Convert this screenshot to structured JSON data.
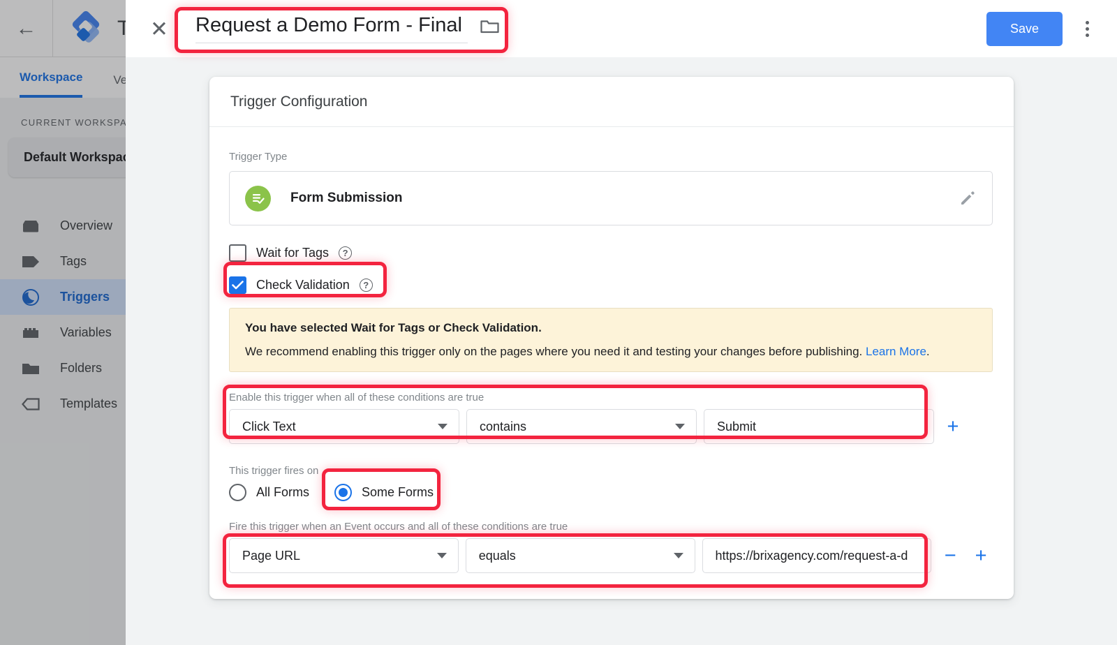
{
  "app": {
    "back_icon": "back-arrow-icon",
    "brand_title": "Tag Manager",
    "tabs": [
      {
        "label": "Workspace",
        "active": true
      },
      {
        "label": "Versions",
        "active": false
      }
    ],
    "sidebar": {
      "section_label": "CURRENT WORKSPACE",
      "workspace_name": "Default Workspace",
      "items": [
        {
          "label": "Overview",
          "icon": "overview-icon",
          "active": false
        },
        {
          "label": "Tags",
          "icon": "tag-icon",
          "active": false
        },
        {
          "label": "Triggers",
          "icon": "trigger-icon",
          "active": true
        },
        {
          "label": "Variables",
          "icon": "variables-icon",
          "active": false
        },
        {
          "label": "Folders",
          "icon": "folder-icon",
          "active": false
        },
        {
          "label": "Templates",
          "icon": "template-icon",
          "active": false
        }
      ]
    }
  },
  "modal": {
    "close_icon": "close-icon",
    "title_value": "Request a Demo Form - Final CTA",
    "title_placeholder": "Untitled Trigger",
    "folder_icon": "folder-icon",
    "save_label": "Save",
    "more_icon": "more-vertical-icon",
    "accent_color": "#4285f4",
    "highlight_color": "#f3243f"
  },
  "config": {
    "card_title": "Trigger Configuration",
    "trigger_type_label": "Trigger Type",
    "trigger_type_name": "Form Submission",
    "trigger_type_icon": "form-submission-icon",
    "trigger_type_icon_color": "#8bc34a",
    "edit_icon": "pencil-icon",
    "checkboxes": [
      {
        "label": "Wait for Tags",
        "checked": false,
        "help_icon": "help-circle-icon"
      },
      {
        "label": "Check Validation",
        "checked": true,
        "help_icon": "help-circle-icon"
      }
    ],
    "warning": {
      "strong": "You have selected Wait for Tags or Check Validation.",
      "text": "We recommend enabling this trigger only on the pages where you need it and testing your changes before publishing.",
      "link": "Learn More",
      "link_suffix": ".",
      "bg_color": "#fdf3d9"
    },
    "enable_conditions_label": "Enable this trigger when all of these conditions are true",
    "enable_condition": {
      "variable": "Click Text",
      "operator": "contains",
      "value": "Submit",
      "value_placeholder": "",
      "add_icon": "plus-icon"
    },
    "fires_on_label": "This trigger fires on",
    "fires_on_options": [
      {
        "label": "All Forms",
        "selected": false
      },
      {
        "label": "Some Forms",
        "selected": true
      }
    ],
    "fire_conditions_label": "Fire this trigger when an Event occurs and all of these conditions are true",
    "fire_condition": {
      "variable": "Page URL",
      "operator": "equals",
      "value": "https://brixagency.com/request-a-d",
      "remove_icon": "minus-icon",
      "add_icon": "plus-icon"
    }
  }
}
